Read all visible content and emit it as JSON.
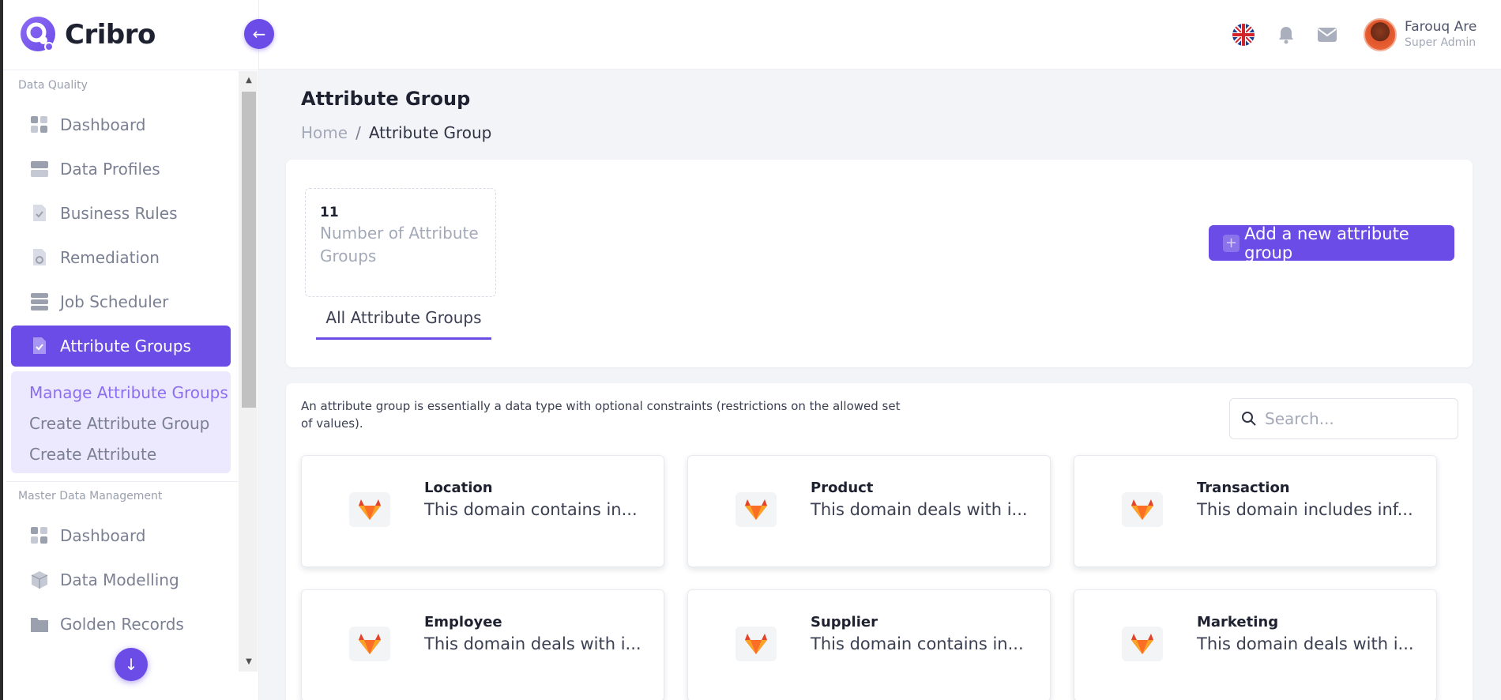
{
  "brand": {
    "name": "Cribro"
  },
  "sidebar": {
    "sections": [
      {
        "title": "Data Quality",
        "items": [
          {
            "label": "Dashboard",
            "icon": "grid-icon"
          },
          {
            "label": "Data Profiles",
            "icon": "table-icon"
          },
          {
            "label": "Business Rules",
            "icon": "document-check-icon"
          },
          {
            "label": "Remediation",
            "icon": "document-gear-icon"
          },
          {
            "label": "Job Scheduler",
            "icon": "server-icon"
          },
          {
            "label": "Attribute Groups",
            "icon": "document-check-icon",
            "active": true
          }
        ],
        "submenu": [
          {
            "label": "Manage Attribute Groups",
            "current": true
          },
          {
            "label": "Create Attribute Group"
          },
          {
            "label": "Create Attribute"
          }
        ]
      },
      {
        "title": "Master Data Management",
        "items": [
          {
            "label": "Dashboard",
            "icon": "grid-icon"
          },
          {
            "label": "Data Modelling",
            "icon": "cube-icon"
          },
          {
            "label": "Golden Records",
            "icon": "folder-icon"
          }
        ]
      }
    ]
  },
  "header": {
    "language_icon": "uk-flag-icon",
    "user": {
      "name": "Farouq Are",
      "role": "Super Admin"
    }
  },
  "page": {
    "title": "Attribute Group",
    "breadcrumb": {
      "home": "Home",
      "separator": "/",
      "current": "Attribute Group"
    }
  },
  "stats": {
    "count": "11",
    "label": "Number of Attribute Groups"
  },
  "actions": {
    "add_label": "Add a new attribute group",
    "add_icon": "+"
  },
  "tabs": [
    {
      "label": "All Attribute Groups",
      "active": true
    }
  ],
  "list": {
    "description": "An attribute group is essentially a data type with optional constraints (restrictions on the allowed set of values).",
    "search_placeholder": "Search...",
    "items": [
      {
        "title": "Location",
        "desc": "This domain contains in..."
      },
      {
        "title": "Product",
        "desc": "This domain deals with i..."
      },
      {
        "title": "Transaction",
        "desc": "This domain includes inf..."
      },
      {
        "title": "Employee",
        "desc": "This domain deals with i..."
      },
      {
        "title": "Supplier",
        "desc": "This domain contains in..."
      },
      {
        "title": "Marketing",
        "desc": "This domain deals with i..."
      }
    ]
  },
  "colors": {
    "accent": "#6b4ce6",
    "accent_light": "#ece8fd",
    "muted": "#7a8092"
  }
}
